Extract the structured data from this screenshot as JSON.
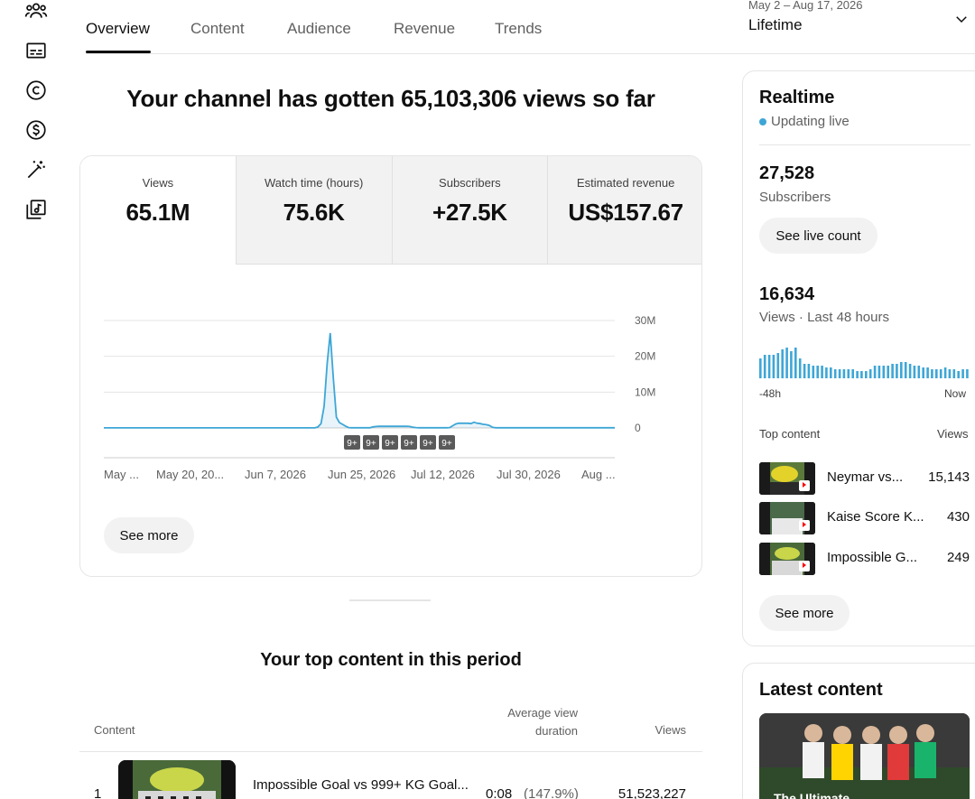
{
  "tabs": [
    {
      "label": "Overview",
      "active": true
    },
    {
      "label": "Content",
      "active": false
    },
    {
      "label": "Audience",
      "active": false
    },
    {
      "label": "Revenue",
      "active": false
    },
    {
      "label": "Trends",
      "active": false
    }
  ],
  "date_range": {
    "sub": "May 2 – Aug 17, 2026",
    "main": "Lifetime"
  },
  "rail_icons": [
    "audience-icon",
    "subtitles-icon",
    "copyright-icon",
    "monetization-icon",
    "customization-icon",
    "audio-library-icon"
  ],
  "headline": "Your channel has gotten 65,103,306 views so far",
  "metrics": [
    {
      "label": "Views",
      "value": "65.1M"
    },
    {
      "label": "Watch time (hours)",
      "value": "75.6K"
    },
    {
      "label": "Subscribers",
      "value": "+27.5K"
    },
    {
      "label": "Estimated revenue",
      "value": "US$157.67"
    }
  ],
  "chart_data": {
    "type": "area",
    "x_tick_labels": [
      "May ...",
      "May 20, 20...",
      "Jun 7, 2026",
      "Jun 25, 2026",
      "Jul 12, 2026",
      "Jul 30, 2026",
      "Aug ..."
    ],
    "y_ticks": [
      "30M",
      "20M",
      "10M",
      "0"
    ],
    "ylim": [
      0,
      30000000
    ],
    "grid": true,
    "values": [
      0.02,
      0.02,
      0.02,
      0.02,
      0.02,
      0.02,
      0.02,
      0.02,
      0.02,
      0.02,
      0.02,
      0.02,
      0.02,
      0.02,
      0.02,
      0.02,
      0.02,
      0.02,
      0.02,
      0.02,
      0.02,
      0.02,
      0.02,
      0.02,
      0.02,
      0.02,
      0.02,
      0.02,
      0.02,
      0.02,
      0.02,
      0.02,
      0.02,
      0.02,
      0.02,
      0.02,
      0.02,
      0.02,
      0.02,
      0.02,
      0.02,
      0.02,
      0.02,
      0.02,
      0.02,
      0.02,
      0.02,
      0.02,
      0.02,
      0.02,
      0.02,
      0.02,
      0.02,
      0.02,
      0.02,
      0.02,
      0.02,
      0.02,
      0.02,
      0.02,
      0.02,
      0.02,
      0.02,
      0.02,
      0.02,
      0.02,
      0.02,
      0.02,
      0.02,
      0.02,
      0.3,
      1.2,
      6.0,
      18.0,
      26.5,
      14.0,
      3.0,
      1.5,
      1.0,
      0.5,
      0.1,
      0.05,
      0.05,
      0.05,
      0.05,
      0.05,
      0.05,
      0.05,
      0.3,
      0.4,
      0.45,
      0.45,
      0.45,
      0.45,
      0.45,
      0.45,
      0.45,
      0.45,
      0.45,
      0.45,
      0.4,
      0.2,
      0.1,
      0.05,
      0.05,
      0.05,
      0.05,
      0.05,
      0.05,
      0.05,
      0.05,
      0.05,
      0.05,
      0.1,
      0.6,
      1.1,
      1.3,
      1.3,
      1.3,
      1.3,
      1.2,
      1.6,
      1.3,
      1.2,
      1.0,
      0.9,
      0.7,
      0.2,
      0.05,
      0.05,
      0.05,
      0.05,
      0.05,
      0.05,
      0.05,
      0.05,
      0.05,
      0.05,
      0.05,
      0.05,
      0.05,
      0.05,
      0.05,
      0.05,
      0.05,
      0.05,
      0.05,
      0.05,
      0.05,
      0.05,
      0.05,
      0.05,
      0.05,
      0.05,
      0.05,
      0.05,
      0.05,
      0.05,
      0.05,
      0.05,
      0.05,
      0.05,
      0.05,
      0.05,
      0.05,
      0.05,
      0.05,
      0.05
    ],
    "value_unit": "M",
    "markers": [
      "9+",
      "9+",
      "9+",
      "9+",
      "9+",
      "9+"
    ],
    "line_color": "#3ea6d6"
  },
  "see_more": "See more",
  "top_content": {
    "title": "Your top content in this period",
    "col_content": "Content",
    "col_avg_line1": "Average view",
    "col_avg_line2": "duration",
    "col_views": "Views",
    "rows": [
      {
        "rank": "1",
        "title": "Impossible Goal vs 999+ KG Goal...",
        "duration": "0:08",
        "pct": "(147.9%)",
        "views": "51,523,227"
      }
    ]
  },
  "realtime": {
    "title": "Realtime",
    "live_label": "Updating live",
    "live_color": "#3ea6d6",
    "subscribers": "27,528",
    "subscribers_label": "Subscribers",
    "live_count_btn": "See live count",
    "views": "16,634",
    "views_label": "Views · Last 48 hours",
    "bars": [
      0.55,
      0.65,
      0.65,
      0.65,
      0.7,
      0.8,
      0.85,
      0.75,
      0.85,
      0.55,
      0.4,
      0.4,
      0.35,
      0.35,
      0.35,
      0.3,
      0.3,
      0.25,
      0.25,
      0.25,
      0.25,
      0.25,
      0.2,
      0.2,
      0.2,
      0.25,
      0.35,
      0.35,
      0.35,
      0.35,
      0.4,
      0.4,
      0.45,
      0.45,
      0.4,
      0.35,
      0.35,
      0.3,
      0.3,
      0.25,
      0.25,
      0.25,
      0.3,
      0.25,
      0.25,
      0.2,
      0.25,
      0.25
    ],
    "axis_left": "-48h",
    "axis_right": "Now",
    "top_content_label": "Top content",
    "top_views_label": "Views",
    "items": [
      {
        "title": "Neymar vs...",
        "views": "15,143"
      },
      {
        "title": "Kaise Score K...",
        "views": "430"
      },
      {
        "title": "Impossible G...",
        "views": "249"
      }
    ],
    "see_more": "See more"
  },
  "latest": {
    "title": "Latest content",
    "caption": "The Ultimate"
  }
}
